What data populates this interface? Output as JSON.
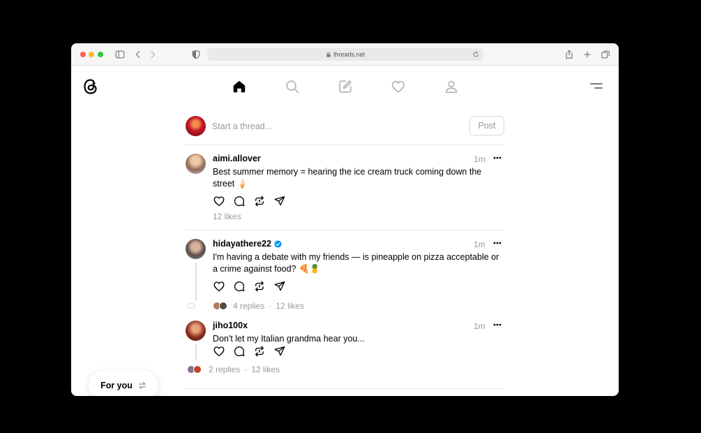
{
  "browser": {
    "url": "threads.net"
  },
  "composer": {
    "placeholder": "Start a thread...",
    "post_label": "Post"
  },
  "posts": [
    {
      "username": "aimi.allover",
      "verified": false,
      "time": "1m",
      "text": "Best summer memory = hearing the ice cream truck coming down the street 🍦",
      "likes": "12 likes"
    },
    {
      "username": "hidayathere22",
      "verified": true,
      "time": "1m",
      "text": "I'm having a debate with my friends — is pineapple on pizza acceptable or a crime against food? 🍕🍍",
      "replies": "4 replies",
      "likes": "12 likes"
    },
    {
      "username": "jiho100x",
      "verified": false,
      "time": "1m",
      "text": "Don't let my Italian grandma hear you...",
      "replies": "2 replies",
      "likes": "12 likes"
    }
  ],
  "feed_switch": {
    "label": "For you"
  },
  "colors": {
    "verified": "#0095f6",
    "muted": "#999999",
    "traffic_red": "#ff5f57",
    "traffic_yellow": "#febc2e",
    "traffic_green": "#28c840"
  },
  "icons": {
    "logo": "threads-logo",
    "nav": [
      "home-icon",
      "search-icon",
      "compose-icon",
      "heart-icon",
      "profile-icon"
    ],
    "actions": [
      "like-icon",
      "comment-icon",
      "repost-icon",
      "share-icon"
    ]
  }
}
